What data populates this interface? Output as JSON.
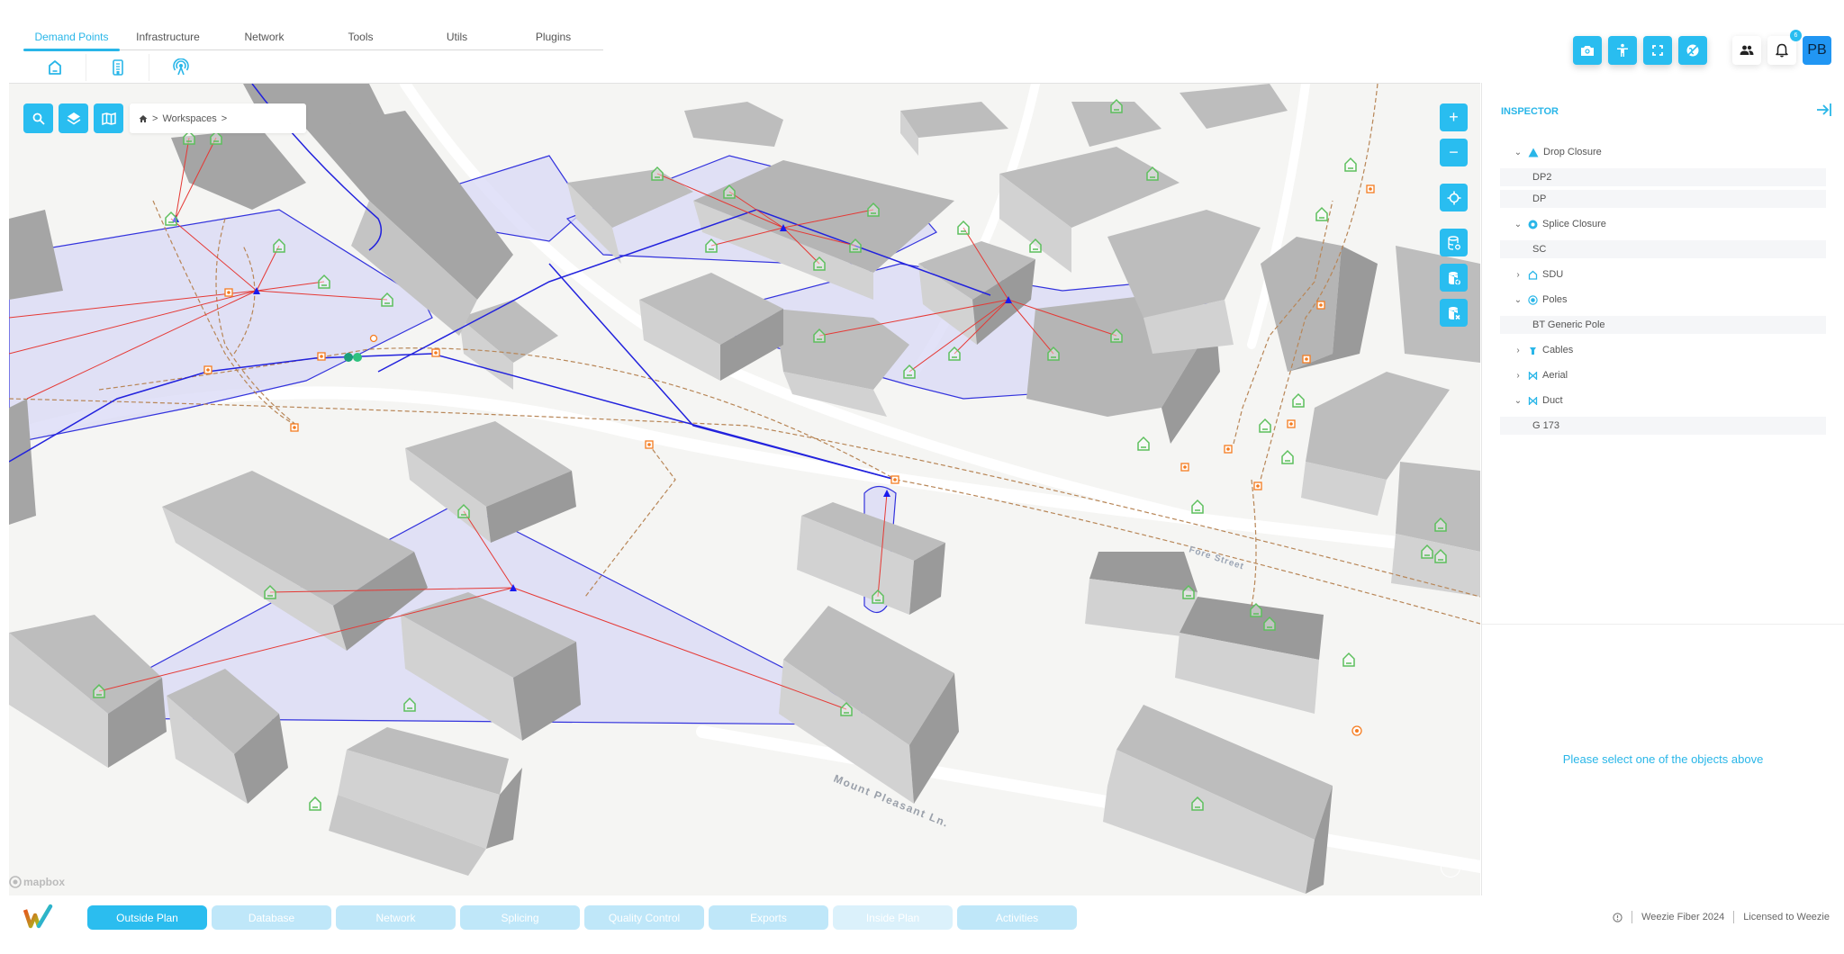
{
  "toolbar": {
    "tabs": [
      {
        "label": "Demand Points",
        "active": true
      },
      {
        "label": "Infrastructure",
        "active": false
      },
      {
        "label": "Network",
        "active": false
      },
      {
        "label": "Tools",
        "active": false
      },
      {
        "label": "Utils",
        "active": false
      },
      {
        "label": "Plugins",
        "active": false
      }
    ],
    "sub_icons": [
      "house-icon",
      "building-icon",
      "antenna-icon"
    ]
  },
  "header_actions": {
    "buttons": [
      "camera-icon",
      "accessibility-icon",
      "fullscreen-icon",
      "globe-off-icon"
    ],
    "users_icon": "users-icon",
    "notifications_icon": "bell-icon",
    "notification_count": "6",
    "avatar_initials": "PB"
  },
  "map": {
    "controls": [
      "search-icon",
      "layers-icon",
      "map-icon"
    ],
    "breadcrumb": {
      "home_icon": "home-icon",
      "items": [
        ">",
        "Workspaces",
        ">"
      ]
    },
    "zoom_in": "+",
    "zoom_out": "−",
    "right_controls": [
      "locate-icon",
      "database-refresh-icon",
      "database-sync-icon",
      "database-remove-icon"
    ],
    "street_labels": [
      "Mount Pleasant Ln.",
      "Fore Street"
    ],
    "attribution": "mapbox",
    "colors": {
      "building": "#a9a9a9",
      "polygon_fill": "#d8d8f6",
      "polygon_stroke": "#3333dd",
      "drop_line": "#e53935",
      "duct_line": "#b88657",
      "pole": "#f57c20",
      "demand_point": "#5cbf5c"
    }
  },
  "inspector": {
    "title": "INSPECTOR",
    "groups": [
      {
        "label": "Drop Closure",
        "icon": "triangle-icon",
        "expanded": true,
        "items": [
          "DP2",
          "DP"
        ]
      },
      {
        "label": "Splice Closure",
        "icon": "splice-closure-icon",
        "expanded": true,
        "items": [
          "SC"
        ]
      },
      {
        "label": "SDU",
        "icon": "house-icon",
        "expanded": false,
        "items": []
      },
      {
        "label": "Poles",
        "icon": "pole-icon",
        "expanded": true,
        "items": [
          "BT Generic Pole"
        ]
      },
      {
        "label": "Cables",
        "icon": "cable-icon",
        "expanded": false,
        "items": []
      },
      {
        "label": "Aerial",
        "icon": "aerial-icon",
        "expanded": false,
        "items": []
      },
      {
        "label": "Duct",
        "icon": "duct-icon",
        "expanded": true,
        "items": [
          "G 173"
        ]
      }
    ],
    "empty_message": "Please select one of the objects above"
  },
  "bottom_bar": {
    "tabs": [
      {
        "label": "Outside Plan",
        "state": "active"
      },
      {
        "label": "Database",
        "state": "normal"
      },
      {
        "label": "Network",
        "state": "normal"
      },
      {
        "label": "Splicing",
        "state": "normal"
      },
      {
        "label": "Quality Control",
        "state": "normal"
      },
      {
        "label": "Exports",
        "state": "normal"
      },
      {
        "label": "Inside Plan",
        "state": "faint"
      },
      {
        "label": "Activities",
        "state": "normal"
      }
    ],
    "footer": {
      "info_icon": "info-icon",
      "product": "Weezie Fiber 2024",
      "license": "Licensed to Weezie"
    }
  }
}
